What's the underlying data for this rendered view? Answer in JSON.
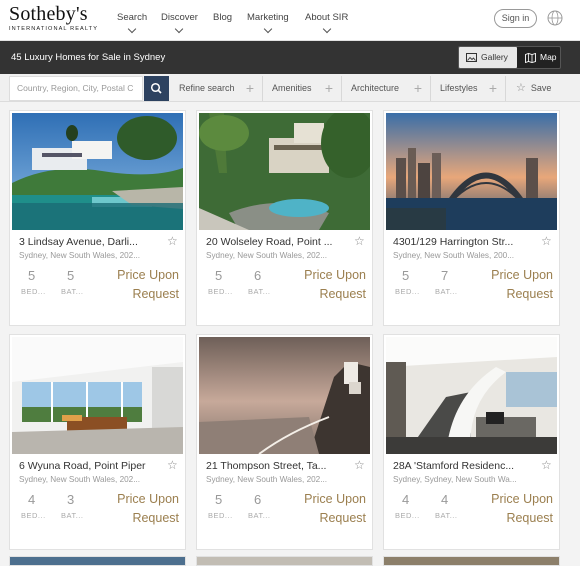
{
  "brand": {
    "name": "Sotheby's",
    "sub": "INTERNATIONAL REALTY"
  },
  "nav": [
    {
      "label": "Search",
      "dropdown": true
    },
    {
      "label": "Discover",
      "dropdown": true
    },
    {
      "label": "Blog",
      "dropdown": false
    },
    {
      "label": "Marketing",
      "dropdown": true
    },
    {
      "label": "About SIR",
      "dropdown": true
    }
  ],
  "header": {
    "signin_label": "Sign in",
    "globe_icon": "globe-icon"
  },
  "results_bar": {
    "title": "45 Luxury Homes for Sale in Sydney",
    "gallery_label": "Gallery",
    "map_label": "Map"
  },
  "filters": {
    "search_placeholder": "Country, Region, City, Postal C",
    "refine_label": "Refine search",
    "amenities_label": "Amenities",
    "architecture_label": "Architecture",
    "lifestyles_label": "Lifestyles",
    "save_label": "Save"
  },
  "listings": [
    {
      "address": "3 Lindsay Avenue, Darli...",
      "location": "Sydney, New South Wales, 202...",
      "beds": "5",
      "baths": "5",
      "bed_label": "BED...",
      "bath_label": "BAT...",
      "price_line1": "Price Upon",
      "price_line2": "Request"
    },
    {
      "address": "20 Wolseley Road, Point ...",
      "location": "Sydney, New South Wales, 202...",
      "beds": "5",
      "baths": "6",
      "bed_label": "BED...",
      "bath_label": "BAT...",
      "price_line1": "Price Upon",
      "price_line2": "Request"
    },
    {
      "address": "4301/129 Harrington Str...",
      "location": "Sydney, New South Wales, 200...",
      "beds": "5",
      "baths": "7",
      "bed_label": "BED...",
      "bath_label": "BAT...",
      "price_line1": "Price Upon",
      "price_line2": "Request"
    },
    {
      "address": "6 Wyuna Road, Point Piper",
      "location": "Sydney, New South Wales, 202...",
      "beds": "4",
      "baths": "3",
      "bed_label": "BED...",
      "bath_label": "BAT...",
      "price_line1": "Price Upon",
      "price_line2": "Request"
    },
    {
      "address": "21 Thompson Street, Ta...",
      "location": "Sydney, New South Wales, 202...",
      "beds": "5",
      "baths": "6",
      "bed_label": "BED...",
      "bath_label": "BAT...",
      "price_line1": "Price Upon",
      "price_line2": "Request"
    },
    {
      "address": "28A 'Stamford Residenc...",
      "location": "Sydney, Sydney, New South Wa...",
      "beds": "4",
      "baths": "4",
      "bed_label": "BED...",
      "bath_label": "BAT...",
      "price_line1": "Price Upon",
      "price_line2": "Request"
    }
  ],
  "colors": {
    "accent_gold": "#9b7f4f",
    "dark_bar": "#333333",
    "search_button": "#2d4260"
  }
}
